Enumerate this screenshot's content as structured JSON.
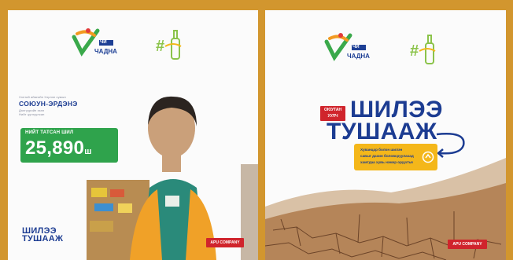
{
  "left_card": {
    "logo_text_1": "ЧИ",
    "logo_text_2": "ЧАДНА",
    "small_text_1": "Хэнтий аймгийн Хэрлэн сумын",
    "name": "СОЮУН-ЭРДЭНЭ",
    "small_text_2": "Дэлгүүрийн эзэн",
    "small_text_3": "Нийт цуглуулсан",
    "total_label": "НИЙТ ТАТСАН ШИЛ",
    "total_value": "25,890",
    "total_unit": "ш",
    "brand_line_1": "ШИЛЭЭ",
    "brand_line_2": "ТУШААЖ",
    "company_tag": "APU COMPANY"
  },
  "right_card": {
    "logo_text_1": "ЧИ",
    "logo_text_2": "ЧАДНА",
    "red_badge_1": "ОЮУТАН",
    "red_badge_2": "УУЛЧ",
    "title_line_1": "ШИЛЭЭ",
    "title_line_2": "ТУШААЖ",
    "yellow_line_1": "Хуванцар болон шилэн",
    "yellow_line_2": "савыг дахин боловсруулахад",
    "yellow_line_3": "хамтдаа хувь нэмэр оруулъя",
    "company_tag": "APU COMPANY"
  }
}
